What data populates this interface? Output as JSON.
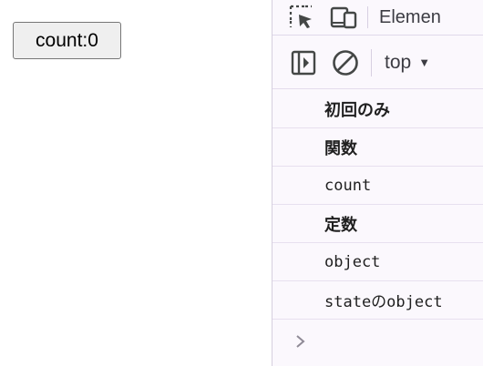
{
  "page": {
    "count_button_label": "count:0"
  },
  "devtools": {
    "tabs": [
      {
        "label": "Elemen"
      }
    ],
    "toolbar": {
      "context": "top"
    },
    "console_messages": [
      {
        "text": "初回のみ"
      },
      {
        "text": "関数"
      },
      {
        "text": "count"
      },
      {
        "text": "定数"
      },
      {
        "text": "object"
      },
      {
        "text": "stateのobject"
      }
    ]
  },
  "icons": {
    "inspect": "inspect-element-icon",
    "device": "device-toolbar-icon",
    "sidebar": "show-console-sidebar-icon",
    "clear": "clear-console-icon",
    "dropdown": "chevron-down-icon",
    "prompt": "chevron-right-icon"
  },
  "colors": {
    "devtools_bg": "#fbf8fd",
    "row_border": "#e7e0ef",
    "icon": "#444746"
  }
}
